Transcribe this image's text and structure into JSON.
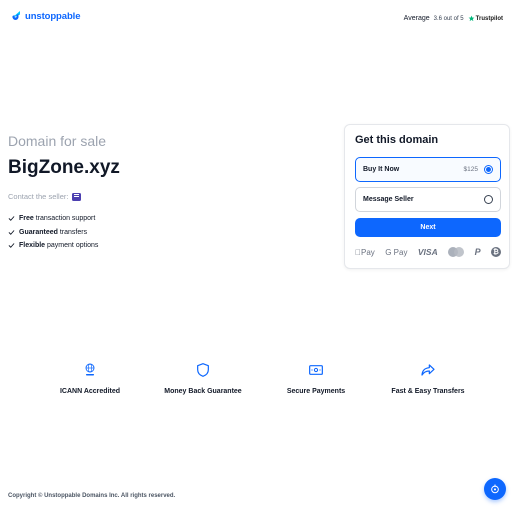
{
  "header": {
    "logo_text": "unstoppable",
    "rating_label": "Average",
    "rating_score": "3.6 out of 5",
    "trustpilot_label": "Trustpilot"
  },
  "listing": {
    "for_sale_label": "Domain for sale",
    "domain": "BigZone.xyz",
    "contact_label": "Contact the seller:",
    "features": [
      {
        "bold": "Free",
        "text": " transaction support"
      },
      {
        "bold": "Guaranteed",
        "text": " transfers"
      },
      {
        "bold": "Flexible",
        "text": " payment options"
      }
    ]
  },
  "purchase_card": {
    "title": "Get this domain",
    "options": [
      {
        "label": "Buy It Now",
        "price": "$125",
        "selected": true
      },
      {
        "label": "Message Seller",
        "price": "",
        "selected": false
      }
    ],
    "next_label": "Next",
    "payment_methods": {
      "apple_pay": "Pay",
      "google_pay": "G Pay",
      "visa": "VISA",
      "icons": [
        "apple-pay-icon",
        "google-pay-icon",
        "visa-icon",
        "mastercard-icon",
        "paypal-icon",
        "bitcoin-icon"
      ]
    }
  },
  "trust_badges": [
    {
      "label": "ICANN Accredited",
      "icon": "icann-icon"
    },
    {
      "label": "Money Back Guarantee",
      "icon": "shield-icon"
    },
    {
      "label": "Secure Payments",
      "icon": "cash-icon"
    },
    {
      "label": "Fast & Easy Transfers",
      "icon": "forward-arrow-icon"
    }
  ],
  "footer": {
    "copyright": "Copyright © Unstoppable Domains Inc. All rights reserved."
  },
  "colors": {
    "accent": "#0d67fe",
    "muted_text": "#9ca3af",
    "chat_button": "#4c3fb0"
  }
}
